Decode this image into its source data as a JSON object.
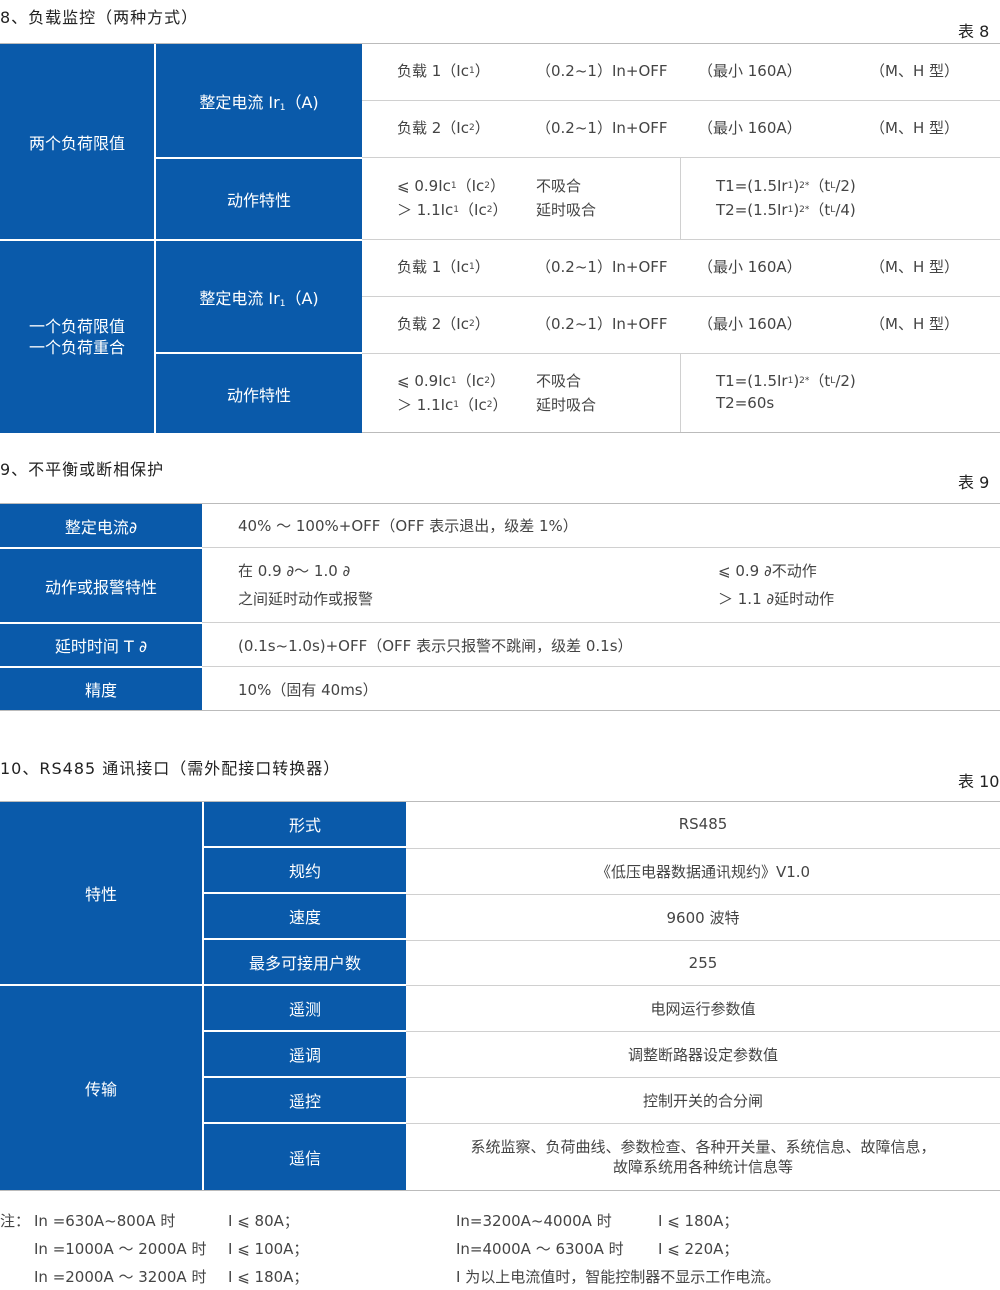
{
  "s8": {
    "title": "8、负载监控（两种方式）",
    "table_no": "表 8",
    "g1": "两个负荷限值",
    "g2a": "一个负荷限值",
    "g2b": "一个负荷重合",
    "set_cur": "整定电流 Ir",
    "set_cur_sub": "1",
    "set_cur_unit": "（A)",
    "action": "动作特性",
    "load1": "负载 1（Ic",
    "load1_sub": "1",
    "load2": "负载 2（Ic",
    "load2_sub": "2",
    "close": "）",
    "range": "（0.2~1）In+OFF",
    "min": "（最小 160A）",
    "type": "（M、H 型）",
    "le": "⩽ 0.9Ic",
    "gt": "＞ 1.1Ic",
    "ic2": "（Ic",
    "no_pick": "不吸合",
    "delay_pick": "延时吸合",
    "t1": "T1=(1.5Ir",
    "t1_end": "）",
    "t1_tail": "（t",
    "t1_half": "/2)",
    "t2": "T2=(1.5Ir",
    "t2_quarter": "/4)",
    "t2_60": "T2=60s",
    "sup": "2*",
    "l_sub": "L"
  },
  "s9": {
    "title": "9、不平衡或断相保护",
    "table_no": "表 9",
    "rows": [
      {
        "label": "整定电流∂",
        "value": "40% ～ 100%+OFF（OFF 表示退出，级差 1%）"
      },
      {
        "label": "动作或报警特性",
        "value1": "在 0.9 ∂～ 1.0 ∂",
        "value2": "之间延时动作或报警",
        "value3": "⩽ 0.9 ∂不动作",
        "value4": "＞ 1.1 ∂延时动作"
      },
      {
        "label": "延时时间 T ∂",
        "value": "(0.1s~1.0s)+OFF（OFF 表示只报警不跳闸，级差 0.1s）"
      },
      {
        "label": "精度",
        "value": "10%（固有 40ms）"
      }
    ]
  },
  "s10": {
    "title": "10、RS485 通讯接口（需外配接口转换器）",
    "table_no": "表 10",
    "g1": "特性",
    "g2": "传输",
    "rows": [
      {
        "label": "形式",
        "value": "RS485"
      },
      {
        "label": "规约",
        "value": "《低压电器数据通讯规约》V1.0"
      },
      {
        "label": "速度",
        "value": "9600 波特"
      },
      {
        "label": "最多可接用户数",
        "value": "255"
      },
      {
        "label": "遥测",
        "value": "电网运行参数值"
      },
      {
        "label": "遥调",
        "value": "调整断路器设定参数值"
      },
      {
        "label": "遥控",
        "value": "控制开关的合分闸"
      },
      {
        "label": "遥信",
        "value": "系统监察、负荷曲线、参数检查、各种开关量、系统信息、故障信息，",
        "value2": "故障系统用各种统计信息等"
      }
    ]
  },
  "notes": {
    "prefix": "注：",
    "l1a": "In =630A~800A 时",
    "l1b": "I ⩽ 80A；",
    "l1c": "In=3200A~4000A 时",
    "l1d": "I ⩽ 180A；",
    "l2a": "In =1000A ～ 2000A 时",
    "l2b": "I ⩽ 100A；",
    "l2c": "In=4000A ～ 6300A 时",
    "l2d": "I ⩽ 220A；",
    "l3a": "In =2000A ～ 3200A 时",
    "l3b": "I ⩽ 180A；",
    "l3c": "I 为以上电流值时，智能控制器不显示工作电流。"
  }
}
